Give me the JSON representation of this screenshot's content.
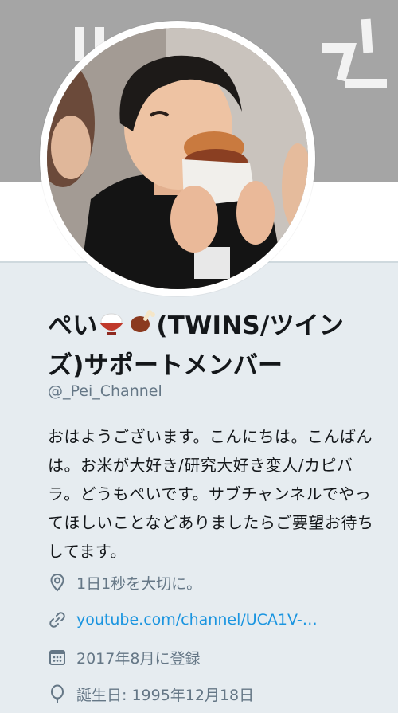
{
  "profile": {
    "display_name_prefix": "ぺい",
    "display_name_suffix": "(TWINS/ツインズ)サポートメンバー",
    "display_name_emojis": [
      "rice-bowl-emoji",
      "meat-on-bone-emoji"
    ],
    "username": "@_Pei_Channel",
    "bio": "おはようございます。こんにちは。こんばんは。お米が大好き/研究大好き変人/カピバラ。どうもぺいです。サブチャンネルでやってほしいことなどありましたらご要望お待ちしてます。",
    "location": "1日1秒を大切に。",
    "url": "youtube.com/channel/UCA1V-…",
    "joined": "2017年8月に登録",
    "birthday": "誕生日: 1995年12月18日"
  },
  "colors": {
    "background": "#e6ecf0",
    "text_primary": "#14171a",
    "text_secondary": "#657786",
    "link": "#1b95e0"
  }
}
